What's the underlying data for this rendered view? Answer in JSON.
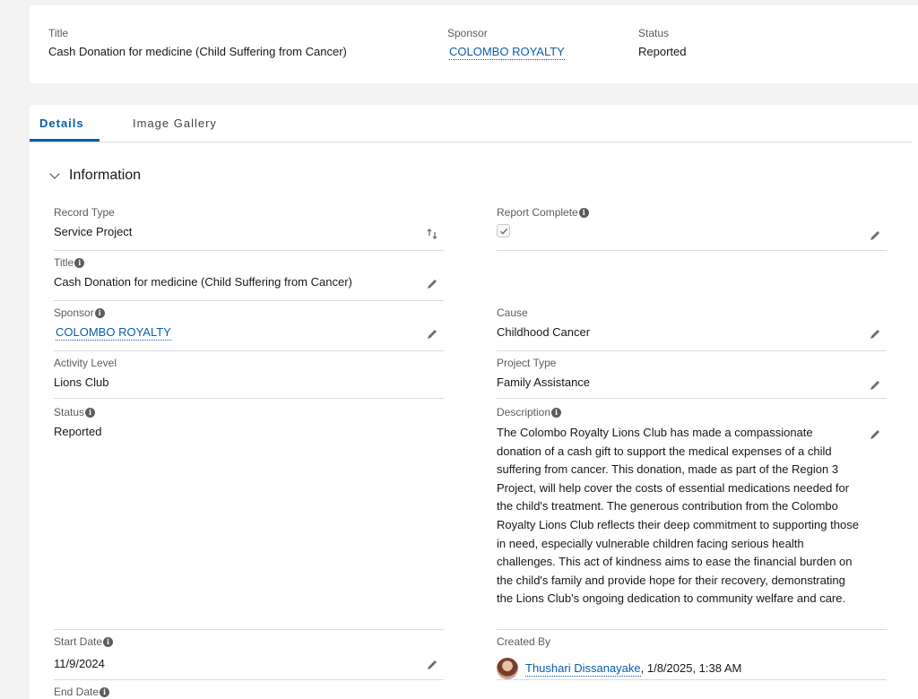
{
  "highlights": {
    "title_label": "Title",
    "title_value": "Cash Donation for medicine (Child Suffering from Cancer)",
    "sponsor_label": "Sponsor",
    "sponsor_value": "COLOMBO ROYALTY",
    "status_label": "Status",
    "status_value": "Reported"
  },
  "tabs": [
    {
      "label": "Details",
      "active": true
    },
    {
      "label": "Image Gallery",
      "active": false
    }
  ],
  "section": {
    "title": "Information"
  },
  "fields": {
    "record_type": {
      "label": "Record Type",
      "value": "Service Project"
    },
    "report_complete": {
      "label": "Report Complete",
      "checked": true
    },
    "title": {
      "label": "Title",
      "value": "Cash Donation for medicine (Child Suffering from Cancer)"
    },
    "sponsor": {
      "label": "Sponsor",
      "value": "COLOMBO ROYALTY"
    },
    "cause": {
      "label": "Cause",
      "value": "Childhood Cancer"
    },
    "activity_level": {
      "label": "Activity Level",
      "value": "Lions Club"
    },
    "project_type": {
      "label": "Project Type",
      "value": "Family Assistance"
    },
    "status": {
      "label": "Status",
      "value": "Reported"
    },
    "description": {
      "label": "Description",
      "value": "The Colombo Royalty Lions Club has made a compassionate donation of a cash gift to support the medical expenses of a child suffering from cancer. This donation, made as part of the Region 3 Project, will help cover the costs of essential medications needed for the child's treatment. The generous contribution from the Colombo Royalty Lions Club reflects their deep commitment to supporting those in need, especially vulnerable children facing serious health challenges. This act of kindness aims to ease the financial burden on the child's family and provide hope for their recovery, demonstrating the Lions Club's ongoing dedication to community welfare and care."
    },
    "start_date": {
      "label": "Start Date",
      "value": "11/9/2024"
    },
    "created_by": {
      "label": "Created By",
      "user": "Thushari Dissanayake",
      "timestamp": ", 1/8/2025, 1:38 AM"
    },
    "end_date": {
      "label": "End Date"
    }
  },
  "icons": {
    "edit": "pencil-icon",
    "info": "info-icon",
    "lock": "lock-icon",
    "chevron": "chevron-down-icon"
  },
  "colors": {
    "link": "#0b5cab",
    "background": "#f3f3f3",
    "card": "#ffffff",
    "divider": "#dddbda"
  }
}
